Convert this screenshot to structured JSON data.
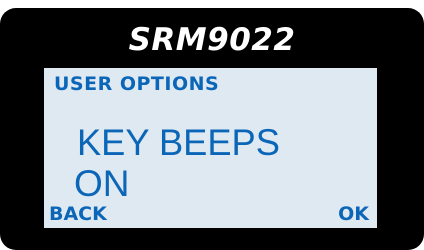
{
  "device": {
    "model": "SRM9022"
  },
  "screen": {
    "menu_title": "USER OPTIONS",
    "setting_name": "KEY BEEPS",
    "setting_value": "ON",
    "softkeys": {
      "left": "BACK",
      "right": "OK"
    }
  },
  "colors": {
    "bezel": "#000000",
    "lcd_background": "#dfe9f2",
    "lcd_text": "#0b66b8",
    "title_text": "#ffffff"
  }
}
